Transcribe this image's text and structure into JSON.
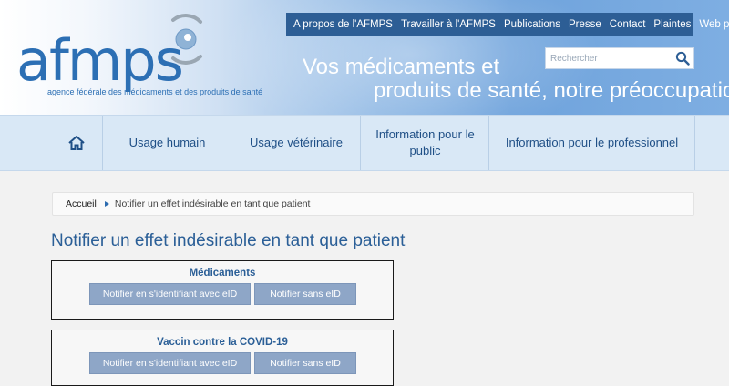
{
  "header": {
    "logo_text": "afmps",
    "logo_subtitle": "agence fédérale des médicaments et des produits de santé",
    "tagline_line1": "Vos médicaments et",
    "tagline_line2": "produits de santé, notre préoccupation",
    "top_links": [
      {
        "label": "A propos de l'AFMPS"
      },
      {
        "label": "Travailler à l'AFMPS"
      },
      {
        "label": "Publications"
      },
      {
        "label": "Presse"
      },
      {
        "label": "Contact"
      },
      {
        "label": "Plaintes"
      },
      {
        "label": "Web portail",
        "icon": "external-link-icon"
      }
    ],
    "search": {
      "placeholder": "Rechercher",
      "value": "",
      "icon": "search-icon"
    }
  },
  "main_nav": {
    "home_icon": "home-icon",
    "items": [
      {
        "label": "Usage humain"
      },
      {
        "label": "Usage vétérinaire"
      },
      {
        "label": "Information pour le public"
      },
      {
        "label": "Information pour le professionnel"
      }
    ]
  },
  "breadcrumb": {
    "home": "Accueil",
    "current": "Notifier un effet indésirable en tant que patient"
  },
  "page": {
    "title": "Notifier un effet indésirable en tant que patient",
    "sections": [
      {
        "title": "Médicaments",
        "button_eid": "Notifier en s'identifiant avec eID",
        "button_no_eid": "Notifier sans eID"
      },
      {
        "title": "Vaccin contre la COVID-19",
        "button_eid": "Notifier en s'identifiant avec eID",
        "button_no_eid": "Notifier sans eID"
      }
    ]
  },
  "colors": {
    "brand_blue": "#2c6fb4",
    "topnav_bg": "#2d5e95",
    "title_blue": "#2b5f97",
    "button_bg": "#8ea6c7",
    "nav_bg": "#d9e8f6"
  }
}
